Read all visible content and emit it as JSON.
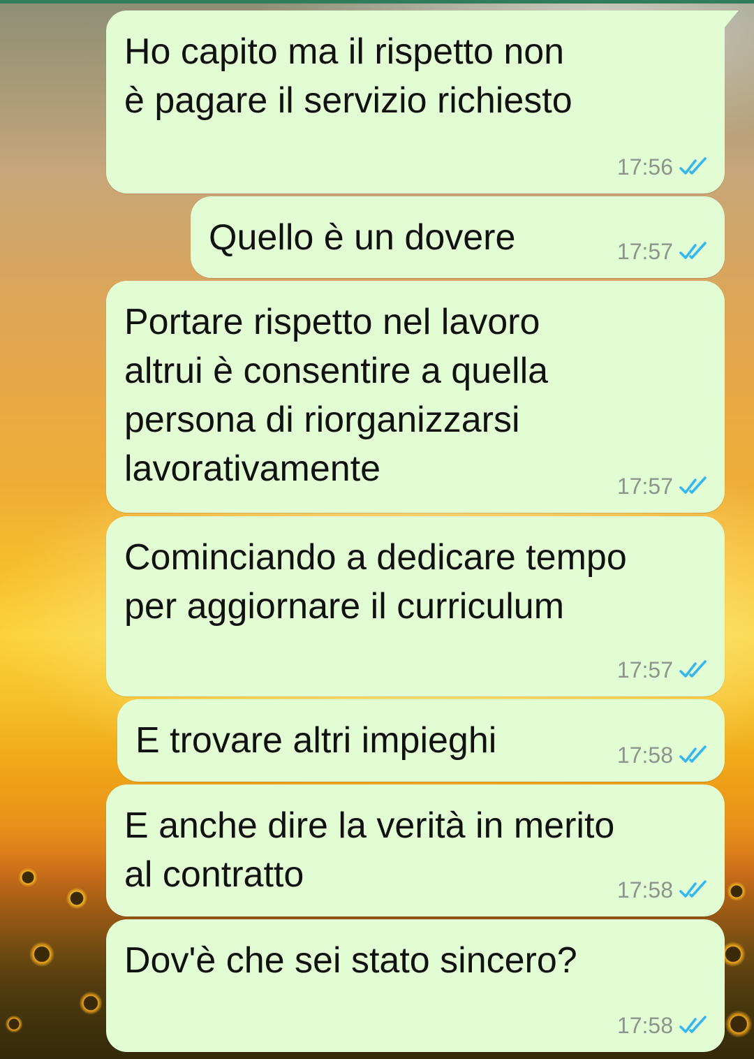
{
  "messages": [
    {
      "text": "Ho capito ma il rispetto non\nè pagare il servizio richiesto",
      "time": "17:56",
      "status": "read"
    },
    {
      "text": "Quello è un dovere",
      "time": "17:57",
      "status": "read"
    },
    {
      "text": "Portare rispetto nel lavoro\naltrui è consentire a quella\npersona di riorganizzarsi\nlavorativamente",
      "time": "17:57",
      "status": "read"
    },
    {
      "text": "Cominciando a dedicare tempo\nper aggiornare il curriculum",
      "time": "17:57",
      "status": "read"
    },
    {
      "text": "E trovare altri impieghi",
      "time": "17:58",
      "status": "read"
    },
    {
      "text": "E anche dire la verità in merito\nal contratto",
      "time": "17:58",
      "status": "read"
    },
    {
      "text": "Dov'è che sei stato sincero?",
      "time": "17:58",
      "status": "read"
    }
  ],
  "colors": {
    "outgoing_bubble": "#e2fdd4",
    "read_ticks": "#34b7f1",
    "timestamp": "#8b958b",
    "header_edge": "#2e7d5b"
  },
  "icons": {
    "read_receipt": "double-check-icon"
  }
}
